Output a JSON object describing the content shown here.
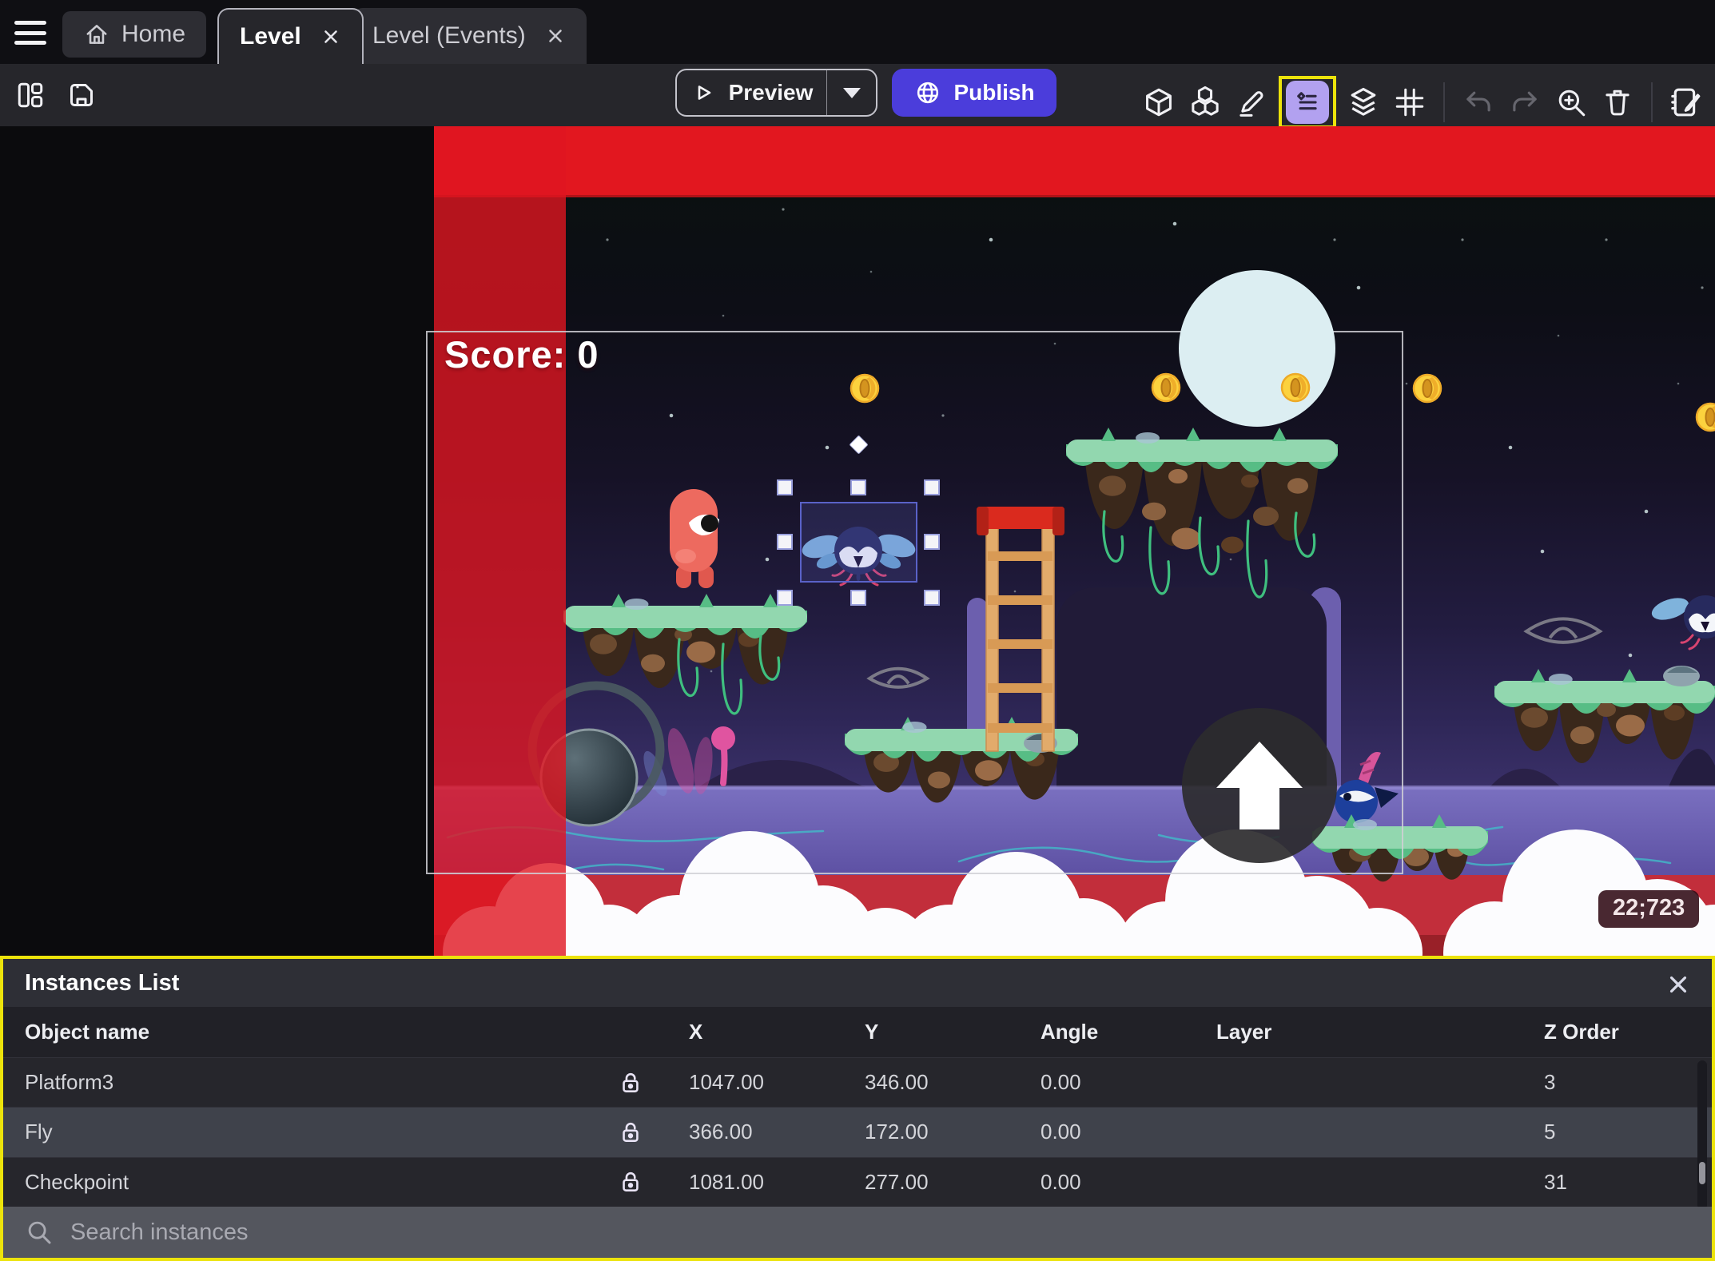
{
  "tab_bar": {
    "tabs": [
      {
        "label": "Home"
      },
      {
        "label": "Level"
      },
      {
        "label": "Level (Events)"
      }
    ]
  },
  "toolbar": {
    "preview_label": "Preview",
    "publish_label": "Publish",
    "left_icons": [
      "panels-layout-icon",
      "save-icon"
    ],
    "right_icons": [
      "3d-box-icon",
      "objects-groups-icon",
      "edit-pencil-icon",
      "instances-list-icon",
      "layers-icon",
      "grid-icon",
      "undo-icon",
      "redo-icon",
      "zoom-in-icon",
      "trash-icon",
      "scene-properties-icon"
    ]
  },
  "scene": {
    "score_text": "Score: 0",
    "coordinates_badge": "22;723"
  },
  "instances_panel": {
    "title": "Instances List",
    "columns": {
      "object_name": "Object name",
      "x": "X",
      "y": "Y",
      "angle": "Angle",
      "layer": "Layer",
      "z_order": "Z Order"
    },
    "rows": [
      {
        "name": "Platform3",
        "x": "1047.00",
        "y": "346.00",
        "angle": "0.00",
        "layer": "",
        "z_order": "3"
      },
      {
        "name": "Fly",
        "x": "366.00",
        "y": "172.00",
        "angle": "0.00",
        "layer": "",
        "z_order": "5"
      },
      {
        "name": "Checkpoint",
        "x": "1081.00",
        "y": "277.00",
        "angle": "0.00",
        "layer": "",
        "z_order": "31"
      }
    ],
    "selected_object": "Fly",
    "search_placeholder": "Search instances"
  },
  "colors": {
    "publish_purple": "#4b3ddb",
    "highlight_yellow": "#ece30b",
    "selected_tool_bg": "#b2a1f0",
    "selection_border": "#5a62c8",
    "band_red": "#e2171f"
  }
}
